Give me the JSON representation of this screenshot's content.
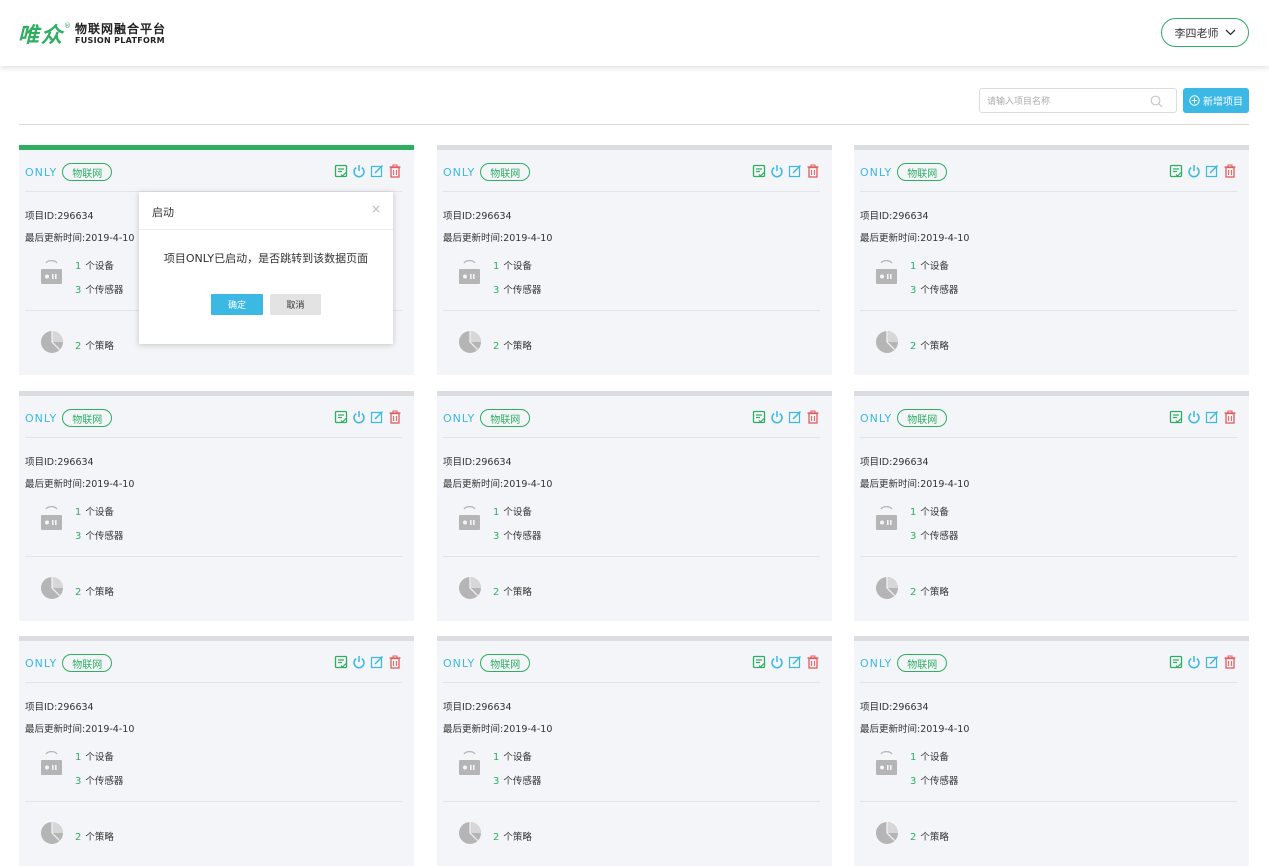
{
  "header": {
    "logo_cn": "唯众",
    "logo_reg": "®",
    "logo_line1": "物联网融合平台",
    "logo_line2": "FUSION PLATFORM",
    "user_name": "李四老师",
    "user_menu_icon": "chevron-down-icon"
  },
  "toolbar": {
    "search_placeholder": "请输入项目名称",
    "search_icon": "search-icon",
    "add_label": "新增项目",
    "add_icon": "plus-circle-icon"
  },
  "colors": {
    "accent_green": "#2fae62",
    "accent_blue": "#3bb8e3",
    "delete_red": "#e35b5b",
    "card_bg": "#f4f5f9"
  },
  "cards": [
    {
      "name": "ONLY",
      "tag": "物联网",
      "id_text": "项目ID:296634",
      "time_text": "最后更新时间:2019-4-10",
      "devices": "1",
      "devices_label": "个设备",
      "sensors": "3",
      "sensors_label": "个传感器",
      "strategies": "2",
      "strategies_label": "个策略",
      "active": true
    },
    {
      "name": "ONLY",
      "tag": "物联网",
      "id_text": "项目ID:296634",
      "time_text": "最后更新时间:2019-4-10",
      "devices": "1",
      "devices_label": "个设备",
      "sensors": "3",
      "sensors_label": "个传感器",
      "strategies": "2",
      "strategies_label": "个策略",
      "active": false
    },
    {
      "name": "ONLY",
      "tag": "物联网",
      "id_text": "项目ID:296634",
      "time_text": "最后更新时间:2019-4-10",
      "devices": "1",
      "devices_label": "个设备",
      "sensors": "3",
      "sensors_label": "个传感器",
      "strategies": "2",
      "strategies_label": "个策略",
      "active": false
    },
    {
      "name": "ONLY",
      "tag": "物联网",
      "id_text": "项目ID:296634",
      "time_text": "最后更新时间:2019-4-10",
      "devices": "1",
      "devices_label": "个设备",
      "sensors": "3",
      "sensors_label": "个传感器",
      "strategies": "2",
      "strategies_label": "个策略",
      "active": false
    },
    {
      "name": "ONLY",
      "tag": "物联网",
      "id_text": "项目ID:296634",
      "time_text": "最后更新时间:2019-4-10",
      "devices": "1",
      "devices_label": "个设备",
      "sensors": "3",
      "sensors_label": "个传感器",
      "strategies": "2",
      "strategies_label": "个策略",
      "active": false
    },
    {
      "name": "ONLY",
      "tag": "物联网",
      "id_text": "项目ID:296634",
      "time_text": "最后更新时间:2019-4-10",
      "devices": "1",
      "devices_label": "个设备",
      "sensors": "3",
      "sensors_label": "个传感器",
      "strategies": "2",
      "strategies_label": "个策略",
      "active": false
    },
    {
      "name": "ONLY",
      "tag": "物联网",
      "id_text": "项目ID:296634",
      "time_text": "最后更新时间:2019-4-10",
      "devices": "1",
      "devices_label": "个设备",
      "sensors": "3",
      "sensors_label": "个传感器",
      "strategies": "2",
      "strategies_label": "个策略",
      "active": false
    },
    {
      "name": "ONLY",
      "tag": "物联网",
      "id_text": "项目ID:296634",
      "time_text": "最后更新时间:2019-4-10",
      "devices": "1",
      "devices_label": "个设备",
      "sensors": "3",
      "sensors_label": "个传感器",
      "strategies": "2",
      "strategies_label": "个策略",
      "active": false
    },
    {
      "name": "ONLY",
      "tag": "物联网",
      "id_text": "项目ID:296634",
      "time_text": "最后更新时间:2019-4-10",
      "devices": "1",
      "devices_label": "个设备",
      "sensors": "3",
      "sensors_label": "个传感器",
      "strategies": "2",
      "strategies_label": "个策略",
      "active": false
    }
  ],
  "card_action_icons": [
    "report-icon",
    "power-icon",
    "edit-icon",
    "delete-icon"
  ],
  "modal": {
    "title": "启动",
    "close_glyph": "×",
    "message": "项目ONLY已启动，是否跳转到该数据页面",
    "confirm_label": "确定",
    "cancel_label": "取消"
  }
}
